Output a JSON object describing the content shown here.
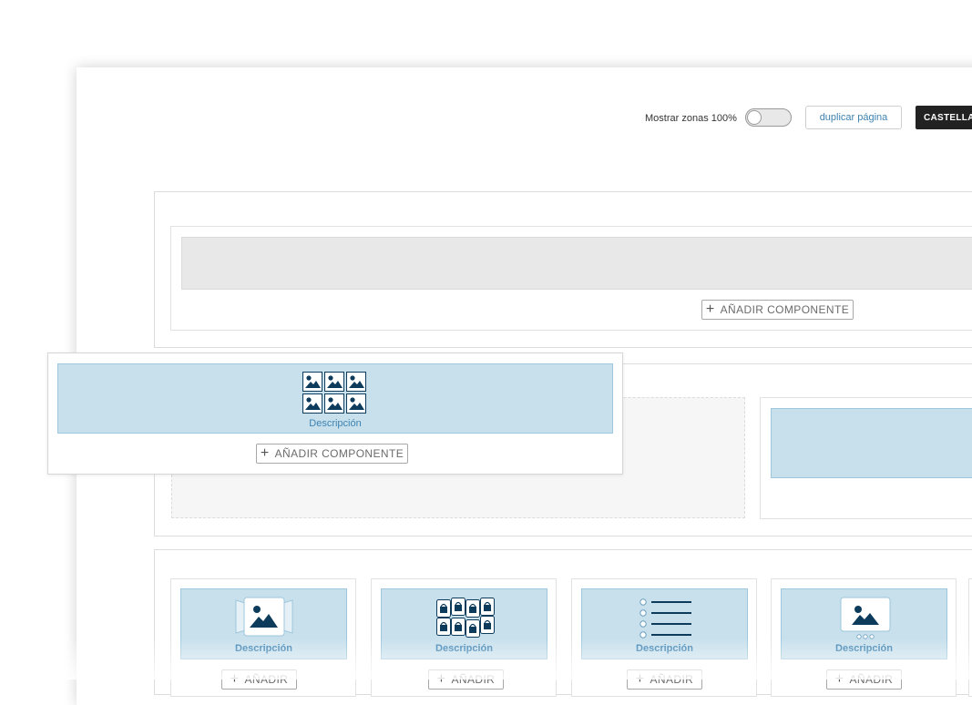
{
  "toolbar": {
    "show_zones_label": "Mostrar zonas 100%",
    "duplicate_label": "duplicar página",
    "language_label": "CASTELLANO"
  },
  "add_component_label": "AÑADIR COMPONENTE",
  "add_short_label": "AÑADIR",
  "floating_component": {
    "description": "Descripción",
    "icon": "image-grid-icon"
  },
  "bottom_components": [
    {
      "description": "Descripción",
      "icon": "image-carousel-icon"
    },
    {
      "description": "Descripción",
      "icon": "product-grid-icon"
    },
    {
      "description": "Descripción",
      "icon": "list-icon"
    },
    {
      "description": "Descripción",
      "icon": "image-slider-icon"
    }
  ],
  "colors": {
    "block_blue": "#c7e0ec",
    "icon_navy": "#0d3b5c",
    "link_blue": "#3d82b2"
  }
}
